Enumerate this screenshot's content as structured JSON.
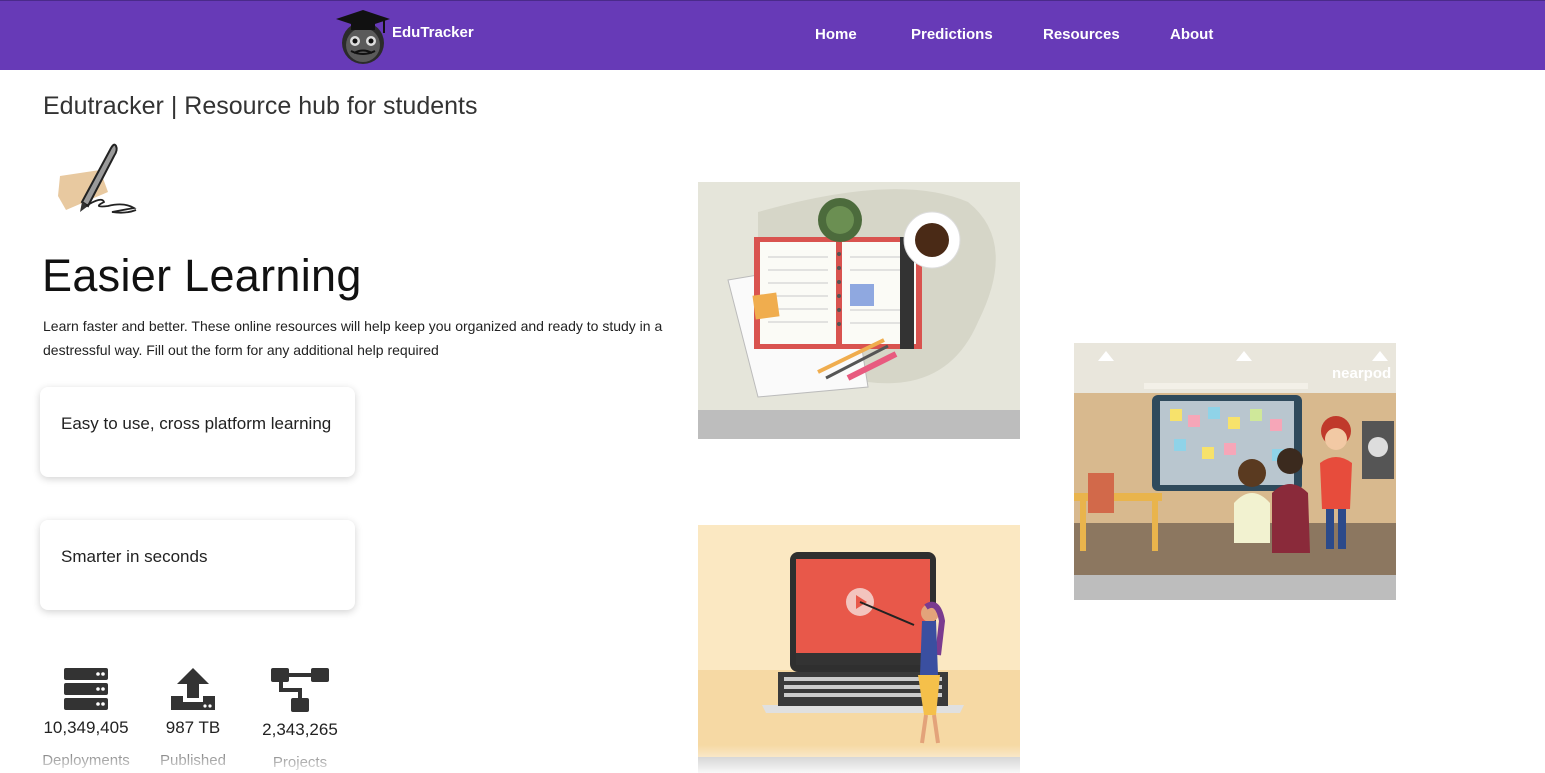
{
  "navbar": {
    "brand": "EduTracker",
    "links": [
      "Home",
      "Predictions",
      "Resources",
      "About"
    ],
    "color": "#673ab7"
  },
  "page": {
    "heading": "Edutracker | Resource hub for students",
    "hero_title": "Easier Learning",
    "hero_description": "Learn faster and better. These online resources will help keep you organized and ready to study in a destressful way. Fill out the form for any additional help required"
  },
  "cards": [
    {
      "label": "Easy to use, cross platform learning"
    },
    {
      "label": "Smarter in seconds"
    }
  ],
  "stats": [
    {
      "value": "10,349,405",
      "label": "Deployments",
      "icon": "server-icon"
    },
    {
      "value": "987 TB",
      "label": "Published",
      "icon": "upload-icon"
    },
    {
      "value": "2,343,265",
      "label": "Projects",
      "icon": "sitemap-icon"
    }
  ],
  "images": {
    "nearpod_logo": "nearpod"
  }
}
